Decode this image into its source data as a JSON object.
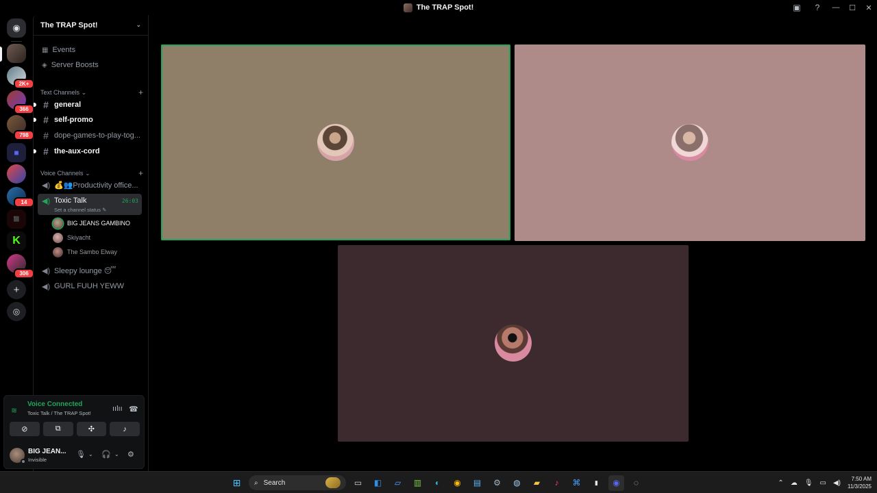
{
  "window": {
    "title": "The TRAP Spot!"
  },
  "rail": {
    "badges": [
      "2K+",
      "366",
      "798",
      "14",
      "306"
    ]
  },
  "server": {
    "name": "The TRAP Spot!",
    "nav": [
      {
        "label": "Events",
        "icon": "calendar-icon"
      },
      {
        "label": "Server Boosts",
        "icon": "boost-icon"
      }
    ]
  },
  "text_category": "Text Channels",
  "text_channels": [
    {
      "name": "general",
      "unread": true
    },
    {
      "name": "self-promo",
      "unread": true
    },
    {
      "name": "dope-games-to-play-tog...",
      "unread": false
    },
    {
      "name": "the-aux-cord",
      "unread": true
    }
  ],
  "voice_category": "Voice Channels",
  "voice_channels": {
    "productivity": "💰👥Productivity office...",
    "active": {
      "name": "Toxic Talk",
      "timer": "26:03",
      "status": "Set a channel status"
    },
    "members": [
      "BIG JEANS GAMBINO",
      "Skiyacht",
      "The Sambo Elway"
    ],
    "sleepy": "Sleepy lounge 😴",
    "gurl": "GURL FUUH YEWW"
  },
  "voice_panel": {
    "title": "Voice Connected",
    "subtitle": "Toxic Talk / The TRAP Spot!"
  },
  "user": {
    "name": "BIG JEAN...",
    "status": "Invisible"
  },
  "tiles": [
    {
      "name": "tile-big-jeans-gambino",
      "color": "#8f7e68"
    },
    {
      "name": "tile-skiyacht",
      "color": "#ae8b89"
    },
    {
      "name": "tile-the-sambo-elway",
      "color": "#3c2a2e"
    }
  ],
  "taskbar": {
    "search": "Search",
    "time": "7:50 AM",
    "date": "11/3/2025"
  },
  "colors": {
    "accent_green": "#23a55a",
    "badge_red": "#f23f43"
  }
}
